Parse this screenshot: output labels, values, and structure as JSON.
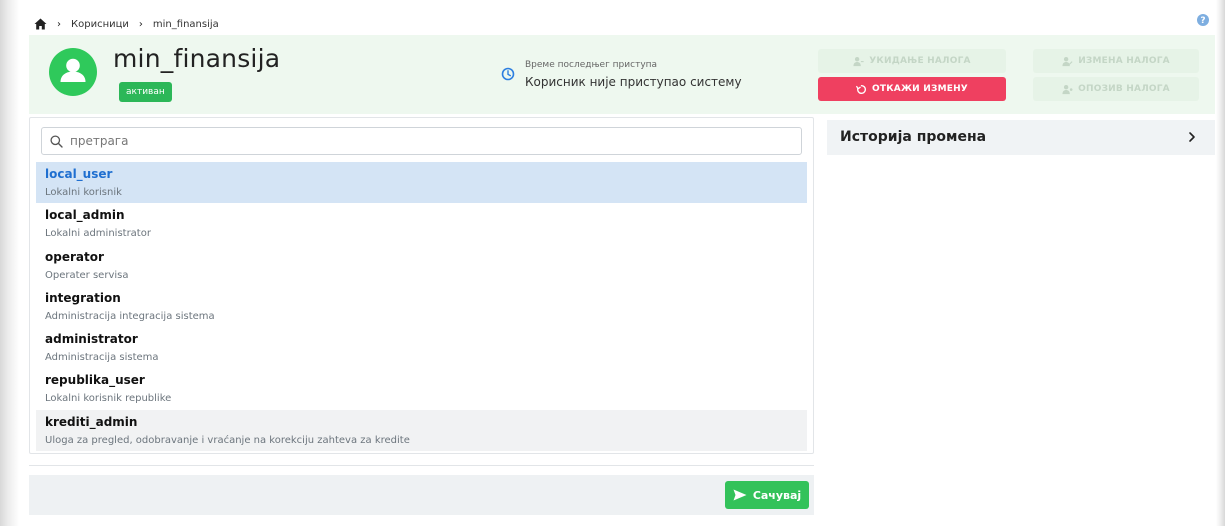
{
  "breadcrumb": {
    "items": [
      "Корисници",
      "min_finansija"
    ]
  },
  "user": {
    "name": "min_finansija",
    "status": "активан"
  },
  "last_access": {
    "label": "Време последњег приступа",
    "value": "Корисник није приступао систему"
  },
  "actions": {
    "cancel_account": "УКИДАЊЕ НАЛОГА",
    "edit_account": "ИЗМЕНА НАЛОГА",
    "cancel_change": "ОТКАЖИ ИЗМЕНУ",
    "revoke_account": "ОПОЗИВ НАЛОГА"
  },
  "search": {
    "placeholder": "претрага",
    "value": ""
  },
  "roles": [
    {
      "name": "local_user",
      "description": "Lokalni korisnik",
      "state": "selected"
    },
    {
      "name": "local_admin",
      "description": "Lokalni administrator",
      "state": ""
    },
    {
      "name": "operator",
      "description": "Operater servisa",
      "state": ""
    },
    {
      "name": "integration",
      "description": "Administracija integracija sistema",
      "state": ""
    },
    {
      "name": "administrator",
      "description": "Administracija sistema",
      "state": ""
    },
    {
      "name": "republika_user",
      "description": "Lokalni korisnik republike",
      "state": ""
    },
    {
      "name": "krediti_admin",
      "description": "Uloga za pregled, odobravanje i vraćanje na korekciju zahteva za kredite",
      "state": "hovered"
    }
  ],
  "history": {
    "title": "Историја промена"
  },
  "footer": {
    "save_label": "Сачувај"
  },
  "colors": {
    "accent_green": "#2fc95b",
    "danger_red": "#ef4060",
    "selected_row": "#d4e4f5",
    "selected_text": "#1f6fd0",
    "header_bg": "#eef8ef"
  },
  "icons": [
    "home-icon",
    "help-icon",
    "user-avatar-icon",
    "clock-icon",
    "user-remove-icon",
    "user-edit-icon",
    "undo-icon",
    "user-revoke-icon",
    "search-icon",
    "chevron-right-icon",
    "send-icon"
  ]
}
